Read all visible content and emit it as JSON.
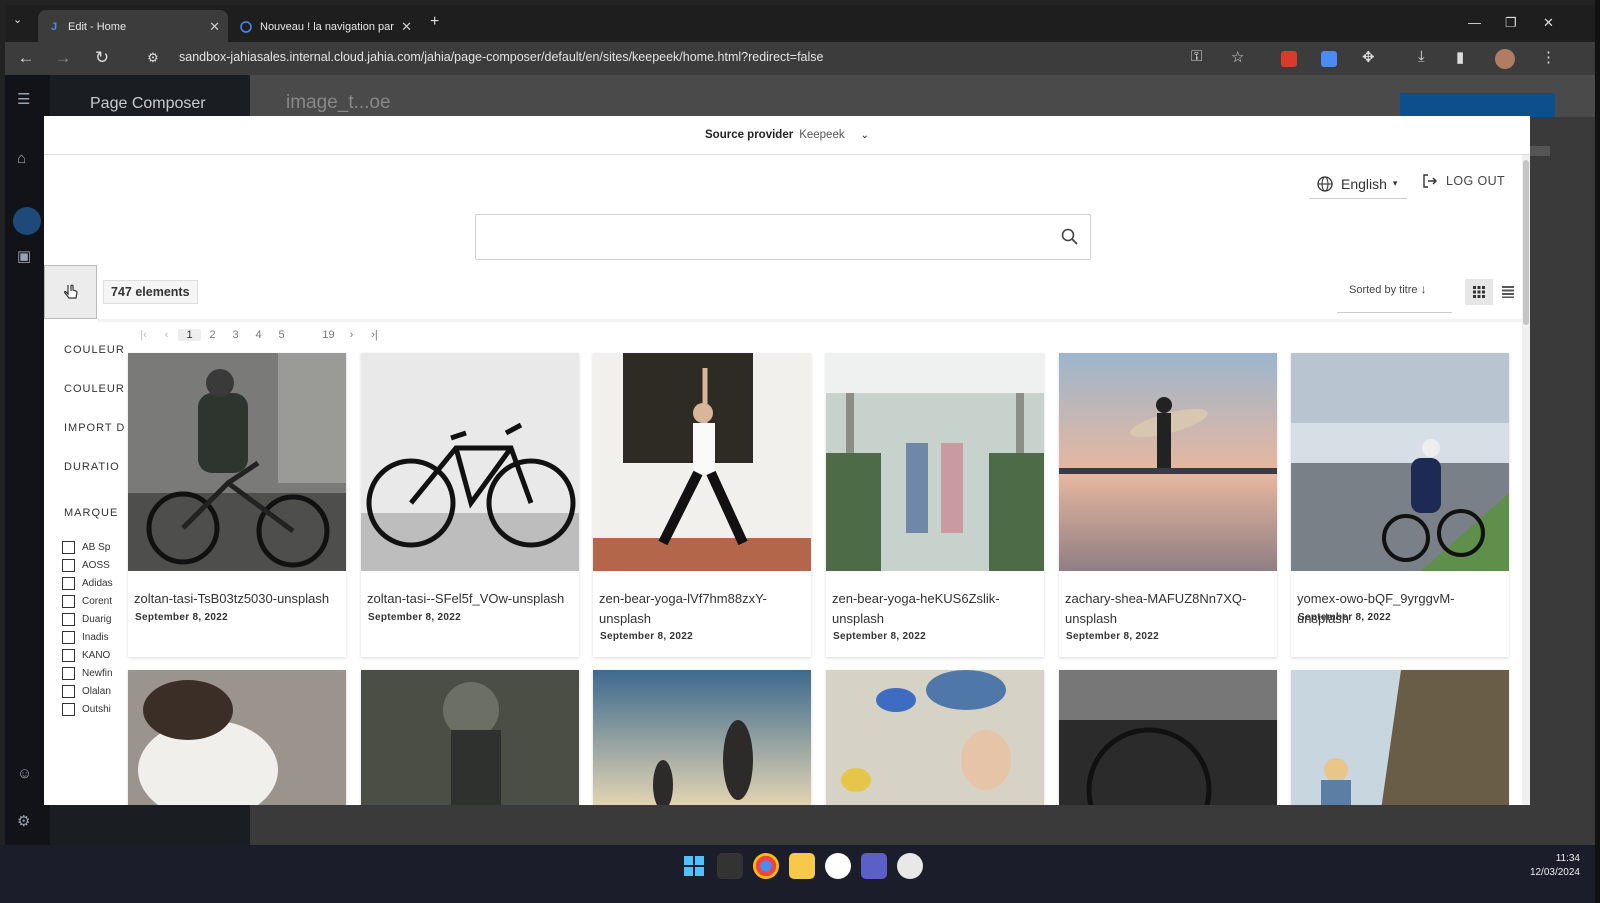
{
  "browser": {
    "tabs": [
      {
        "title": "Edit - Home",
        "favicon": "J"
      },
      {
        "title": "Nouveau ! la navigation par"
      }
    ],
    "url": "sandbox-jahiasales.internal.cloud.jahia.com/jahia/page-composer/default/en/sites/keepeek/home.html?redirect=false"
  },
  "app": {
    "title": "Page Composer",
    "heading": "image_t...oe"
  },
  "modal": {
    "source_label": "Source provider",
    "source_value": "Keepeek",
    "language": "English",
    "logout": "LOG OUT",
    "search_placeholder": "",
    "count": "747 elements",
    "sort_label": "Sorted by",
    "sort_value": "titre",
    "pagination": {
      "pages": [
        "1",
        "2",
        "3",
        "4",
        "5"
      ],
      "last": "19"
    },
    "filters": {
      "headings": [
        "COULEUR",
        "COULEUR",
        "IMPORT D",
        "DURATIO",
        "MARQUE"
      ],
      "brands": [
        "AB Sp",
        "AOSS",
        "Adidas",
        "Corent",
        "Duarig",
        "Inadis",
        "KANO",
        "Newfin",
        "Olalan",
        "Outshi"
      ]
    },
    "assets": [
      {
        "title": "zoltan-tasi-TsB03tz5030-unsplash",
        "date": "September 8, 2022",
        "theme": "cyclist"
      },
      {
        "title": "zoltan-tasi--SFel5f_VOw-unsplash",
        "date": "September 8, 2022",
        "theme": "bike"
      },
      {
        "title": "zen-bear-yoga-lVf7hm88zxY-unsplash",
        "date": "September 8, 2022",
        "theme": "yoga"
      },
      {
        "title": "zen-bear-yoga-heKUS6Zslik-unsplash",
        "date": "September 8, 2022",
        "theme": "yoga-pergola"
      },
      {
        "title": "zachary-shea-MAFUZ8Nn7XQ-unsplash",
        "date": "September 8, 2022",
        "theme": "surfer"
      },
      {
        "title": "yomex-owo-bQF_9yrggvM-unsplash",
        "date": "September 8, 2022",
        "theme": "road-cyclist"
      }
    ],
    "accent_color": "#0b4f8c"
  },
  "system": {
    "time": "11:34",
    "date": "12/03/2024"
  }
}
